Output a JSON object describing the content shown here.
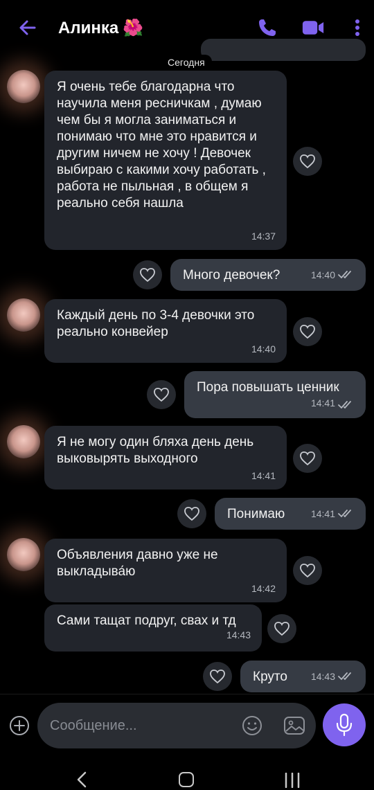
{
  "header": {
    "title": "Алинка",
    "title_emoji": "🌺",
    "accent": "#7f63ee"
  },
  "date_separator": "Сегодня",
  "messages": [
    {
      "dir": "in",
      "text": "Я очень тебе благодарна что научила меня ресничкам , думаю чем бы я могла заниматься и понимаю что мне это нравится и другим ничем не хочу ! Девочек выбираю с какими хочу работать , работа не пыльная , в общем я реально себя нашла",
      "time": "14:37"
    },
    {
      "dir": "out",
      "text": "Много девочек?",
      "time": "14:40"
    },
    {
      "dir": "in",
      "text": "Каждый день по 3-4 девочки это реально конвейер",
      "time": "14:40"
    },
    {
      "dir": "out",
      "text": "Пора повышать ценник",
      "time": "14:41"
    },
    {
      "dir": "in",
      "text": "Я не могу один бляха день день выковырять выходного",
      "time": "14:41"
    },
    {
      "dir": "out",
      "text": "Понимаю",
      "time": "14:41"
    },
    {
      "dir": "in",
      "text": "Объявления давно уже не выкладыва́ю",
      "time": "14:42"
    },
    {
      "dir": "in",
      "text": "Сами тащат подруг, свах и тд",
      "time": "14:43"
    },
    {
      "dir": "out",
      "text": "Круто",
      "time": "14:43"
    }
  ],
  "composer": {
    "placeholder": "Сообщение..."
  },
  "icons": {
    "back": "arrow-left-icon",
    "call": "phone-icon",
    "video": "video-camera-icon",
    "menu": "kebab-menu-icon",
    "like": "heart-outline-icon",
    "read": "double-check-icon",
    "add": "plus-circle-icon",
    "emoji": "smiley-icon",
    "gallery": "image-icon",
    "mic": "microphone-icon"
  }
}
